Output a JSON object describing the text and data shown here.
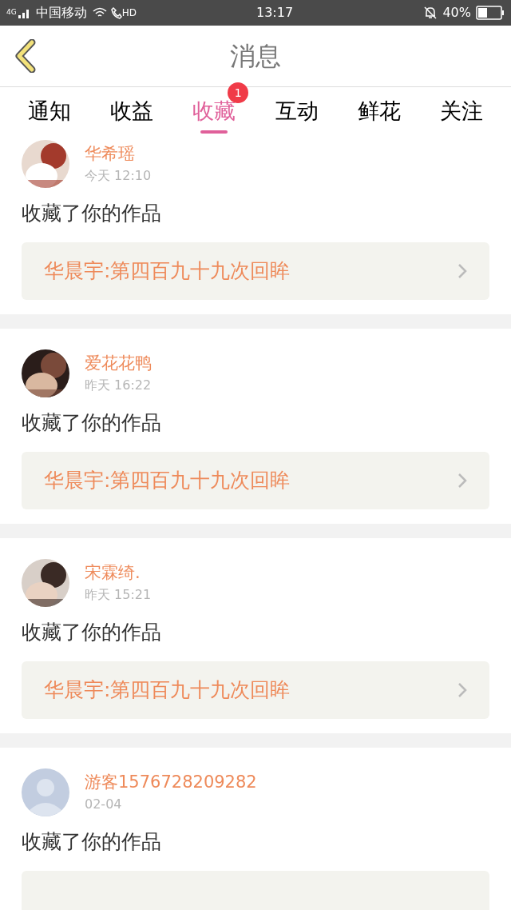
{
  "status_bar": {
    "network": "4G",
    "carrier": "中国移动",
    "call": "HD",
    "time": "13:17",
    "battery": "40%"
  },
  "header": {
    "title": "消息"
  },
  "tabs": [
    {
      "label": "通知",
      "selected": false
    },
    {
      "label": "收益",
      "selected": false
    },
    {
      "label": "收藏",
      "selected": true,
      "badge": "1"
    },
    {
      "label": "互动",
      "selected": false
    },
    {
      "label": "鲜花",
      "selected": false
    },
    {
      "label": "关注",
      "selected": false
    }
  ],
  "messages": [
    {
      "name": "华希瑶",
      "time": "今天 12:10",
      "action": "收藏了你的作品",
      "work": "华晨宇:第四百九十九次回眸",
      "kind": "picture"
    },
    {
      "name": "爱花花鸭",
      "time": "昨天 16:22",
      "action": "收藏了你的作品",
      "work": "华晨宇:第四百九十九次回眸",
      "kind": "picture"
    },
    {
      "name": "宋霖绮.",
      "time": "昨天 15:21",
      "action": "收藏了你的作品",
      "work": "华晨宇:第四百九十九次回眸",
      "kind": "picture"
    },
    {
      "name": "游客1576728209282",
      "time": "02-04",
      "action": "收藏了你的作品",
      "kind": "default"
    }
  ]
}
